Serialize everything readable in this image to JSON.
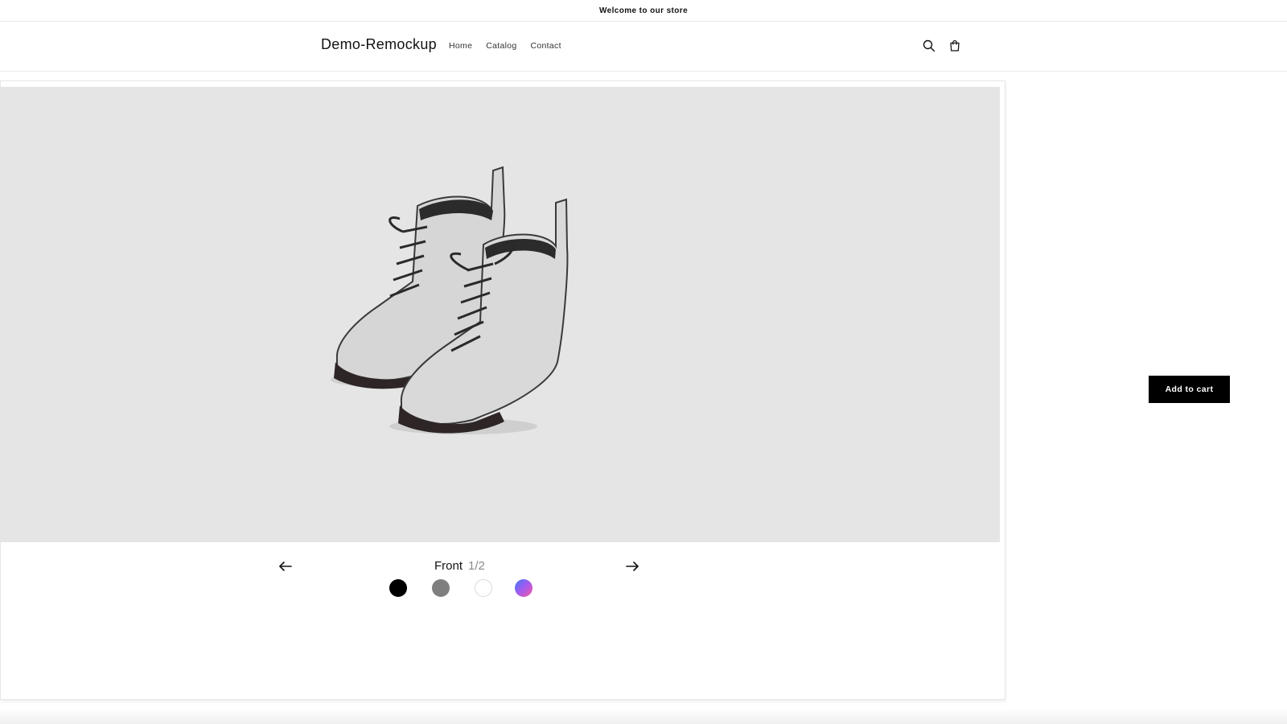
{
  "announcement": {
    "text": "Welcome to our store"
  },
  "header": {
    "logo": "Demo-Remockup",
    "nav": [
      {
        "label": "Home"
      },
      {
        "label": "Catalog"
      },
      {
        "label": "Contact"
      }
    ],
    "icons": {
      "search": "search-icon",
      "cart": "cart-icon"
    }
  },
  "product_viewer": {
    "view_label": "Front",
    "view_counter": "1/2",
    "prev_icon": "arrow-left-icon",
    "next_icon": "arrow-right-icon",
    "image_background": "#e5e5e5",
    "swatches": [
      {
        "name": "black",
        "color": "#000000"
      },
      {
        "name": "gray",
        "color": "#7f7f7f"
      },
      {
        "name": "white",
        "color": "#ffffff"
      },
      {
        "name": "gradient",
        "color": "linear-gradient(#3d7bf5,#a65af0,#f25a9c)"
      }
    ]
  },
  "cta": {
    "add_to_cart_label": "Add to cart"
  }
}
